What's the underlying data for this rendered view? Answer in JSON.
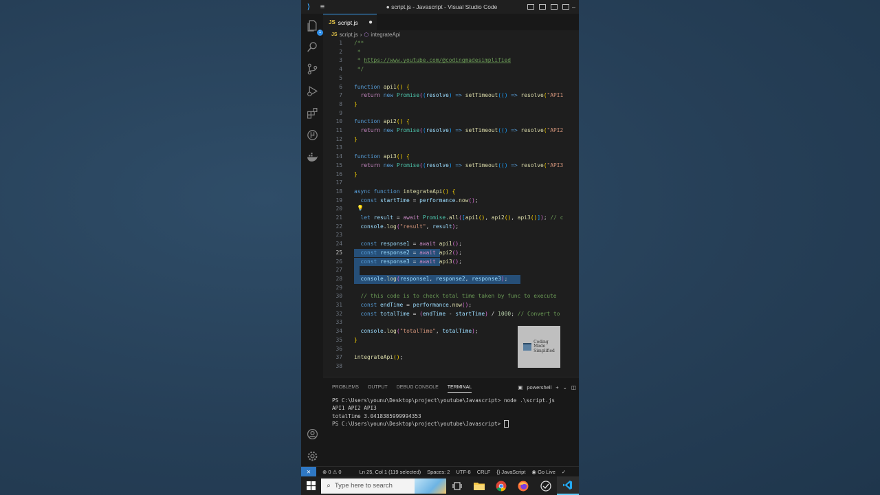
{
  "window": {
    "title": "● script.js - Javascript - Visual Studio Code"
  },
  "tab": {
    "label": "script.js",
    "modified_indicator": "●"
  },
  "breadcrumb": {
    "file": "script.js",
    "separator": "›",
    "symbol": "integrateApi"
  },
  "editor": {
    "current_line": 25,
    "lines": [
      "1",
      "2",
      "3",
      "4",
      "5",
      "6",
      "7",
      "8",
      "9",
      "10",
      "11",
      "12",
      "13",
      "14",
      "15",
      "16",
      "17",
      "18",
      "19",
      "20",
      "21",
      "22",
      "23",
      "24",
      "25",
      "26",
      "27",
      "28",
      "29",
      "30",
      "31",
      "32",
      "33",
      "34",
      "35",
      "36",
      "37",
      "38"
    ],
    "code": {
      "l1": "/**",
      "l2": " *",
      "l3_star": " * ",
      "l3_url": "https://www.youtube.com/@codingmadesimplified",
      "l4": " */",
      "api_names": [
        "api1",
        "api2",
        "api3"
      ],
      "api_values": [
        "\"API1",
        "\"API2",
        "\"API3"
      ],
      "kw_function": "function",
      "kw_return": "return",
      "kw_new": "new",
      "promise": "Promise",
      "resolve": "resolve",
      "settimeout": "setTimeout",
      "arrow": "=>",
      "kw_async": "async",
      "integrate": "integrateApi",
      "kw_const": "const",
      "kw_let": "let",
      "kw_await": "await",
      "startTime": "startTime",
      "endTime": "endTime",
      "totalTime": "totalTime",
      "performance": "performance",
      "now": "now",
      "result": "result",
      "all": "all",
      "l21_comment": "// c",
      "console": "console",
      "log": "log",
      "str_result": "\"result\"",
      "response1": "response1",
      "response2": "response2",
      "response3": "response3",
      "l30_comment": "// this code is to check total time taken by func to execute",
      "num_1000": "1000",
      "l32_comment": "// Convert to",
      "str_totaltime": "\"totalTime\""
    }
  },
  "watermark": {
    "line1": "Coding",
    "line2": "Made",
    "line3": "Simplified"
  },
  "panel": {
    "tabs": [
      "PROBLEMS",
      "OUTPUT",
      "DEBUG CONSOLE",
      "TERMINAL"
    ],
    "active_tab": "TERMINAL",
    "shell": "powershell",
    "add": "+",
    "chevron": "⌄"
  },
  "terminal": {
    "lines": [
      "PS C:\\Users\\younu\\Desktop\\project\\youtube\\Javascript> node .\\script.js",
      "API1 API2 API3",
      "totalTime 3.0418385999994353",
      "PS C:\\Users\\younu\\Desktop\\project\\youtube\\Javascript> "
    ]
  },
  "status": {
    "errors": "⊗ 0 ⚠ 0",
    "position": "Ln 25, Col 1 (119 selected)",
    "spaces": "Spaces: 2",
    "encoding": "UTF-8",
    "eol": "CRLF",
    "language": "{} JavaScript",
    "golive": "Go Live",
    "check": "✓"
  },
  "taskbar": {
    "search_placeholder": "Type here to search"
  },
  "colors": {
    "accent": "#3aa0f3",
    "selection": "#264f78",
    "editor_bg": "#1e1e1e",
    "desktop": "#2b4660"
  }
}
